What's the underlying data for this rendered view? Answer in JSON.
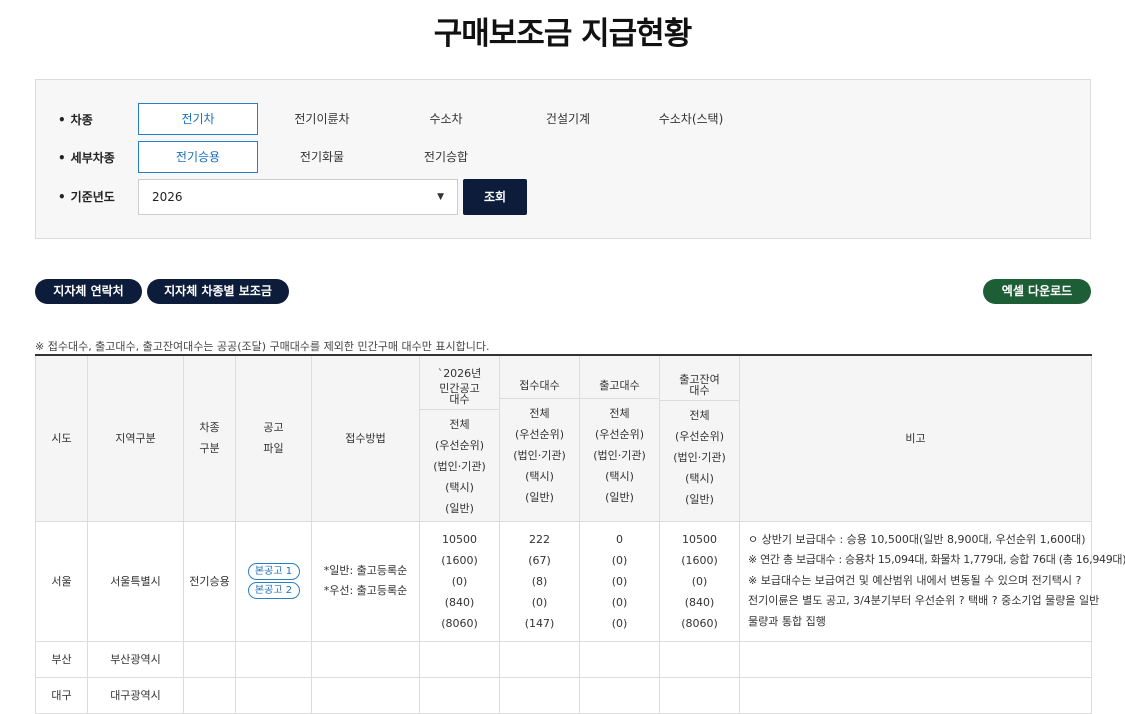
{
  "page_title": "구매보조금 지급현황",
  "filters": {
    "vehicle_type": {
      "label": "차종",
      "options": [
        "전기차",
        "전기이륜차",
        "수소차",
        "건설기계",
        "수소차(스택)"
      ],
      "selected": "전기차"
    },
    "sub_type": {
      "label": "세부차종",
      "options": [
        "전기승용",
        "전기화물",
        "전기승합"
      ],
      "selected": "전기승용"
    },
    "year": {
      "label": "기준년도",
      "value": "2026"
    },
    "search_label": "조회"
  },
  "buttons": {
    "contacts": "지자체 연락처",
    "subsidy_by_type": "지자체 차종별 보조금",
    "excel": "엑셀 다운로드"
  },
  "note": "※ 접수대수, 출고대수, 출고잔여대수는 공공(조달) 구매대수를 제외한 민간구매 대수만 표시합니다.",
  "table": {
    "headers": {
      "city": "시도",
      "region": "지역구분",
      "type": [
        "차종",
        "구분"
      ],
      "notice": [
        "공고",
        "파일"
      ],
      "method": "접수방법",
      "announced": [
        "`2026년",
        "민간공고",
        "대수"
      ],
      "received": "접수대수",
      "released": "출고대수",
      "remaining": [
        "출고잔여",
        "대수"
      ],
      "remarks": "비고",
      "sub_lines": [
        "전체",
        "(우선순위)",
        "(법인·기관)",
        "(택시)",
        "(일반)"
      ]
    },
    "rows": [
      {
        "city": "서울",
        "region": "서울특별시",
        "type": "전기승용",
        "notices": [
          "본공고 1",
          "본공고 2"
        ],
        "method": [
          "*일반: 출고등록순",
          "*우선: 출고등록순"
        ],
        "announced": [
          "10500",
          "(1600)",
          "(0)",
          "(840)",
          "(8060)"
        ],
        "received": [
          "222",
          "(67)",
          "(8)",
          "(0)",
          "(147)"
        ],
        "released": [
          "0",
          "(0)",
          "(0)",
          "(0)",
          "(0)"
        ],
        "remaining": [
          "10500",
          "(1600)",
          "(0)",
          "(840)",
          "(8060)"
        ],
        "remarks": [
          "ㅇ 상반기 보급대수 : 승용 10,500대(일반 8,900대, 우선순위 1,600대)",
          "※ 연간 총 보급대수 : 승용차 15,094대, 화물차 1,779대, 승합 76대 (총 16,949대)",
          "※ 보급대수는 보급여건 및 예산범위 내에서 변동될 수 있으며 전기택시 ?",
          "전기이륜은 별도 공고, 3/4분기부터 우선순위 ? 택배 ? 중소기업 물량을 일반",
          "물량과 통합 집행"
        ]
      },
      {
        "city": "부산",
        "region": "부산광역시"
      },
      {
        "city": "대구",
        "region": "대구광역시"
      }
    ]
  },
  "colors": {
    "navy": "#0c1c3a",
    "excel_green": "#1e5e36",
    "active_blue": "#2a7fc4"
  },
  "icons": {
    "select_caret": "▼"
  }
}
